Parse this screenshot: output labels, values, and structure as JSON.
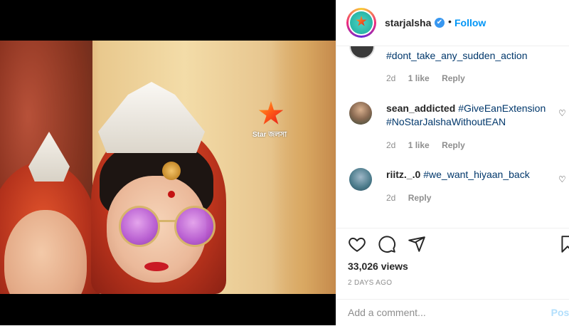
{
  "media": {
    "channel_logo_text": "Star জলসা"
  },
  "header": {
    "username": "starjalsha",
    "verified_mark": "✔",
    "separator": "•",
    "follow_label": "Follow"
  },
  "comments": [
    {
      "user": "",
      "text": "#dont_take_any_sudden_action",
      "time": "2d",
      "likes": "1 like",
      "reply": "Reply"
    },
    {
      "user": "sean_addicted",
      "text": "#GiveEanExtension #NoStarJalshaWithoutEAN",
      "time": "2d",
      "likes": "1 like",
      "reply": "Reply"
    },
    {
      "user": "riitz._.0",
      "text": "#we_want_hiyaan_back",
      "time": "2d",
      "likes": "",
      "reply": "Reply"
    }
  ],
  "icons": {
    "like": "heart-icon",
    "comment": "comment-icon",
    "share": "share-icon",
    "save": "bookmark-icon"
  },
  "stats": {
    "views": "33,026 views",
    "date": "2 DAYS AGO"
  },
  "add_comment": {
    "placeholder": "Add a comment...",
    "post_label": "Post"
  },
  "colors": {
    "link": "#0095f6",
    "hashtag": "#00376b",
    "muted": "#8e8e8e",
    "text": "#262626"
  }
}
